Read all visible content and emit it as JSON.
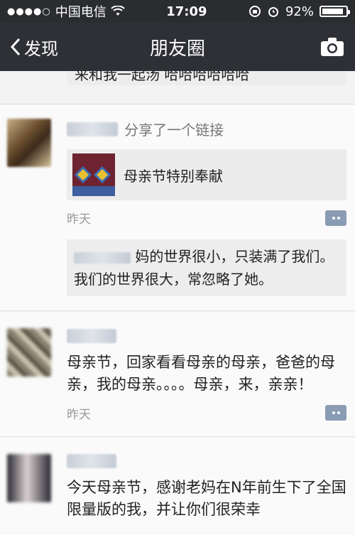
{
  "status_bar": {
    "carrier": "中国电信",
    "time": "17:09",
    "battery": "92%",
    "battery_level": 0.92
  },
  "nav": {
    "back_label": "发现",
    "title": "朋友圈"
  },
  "prev_comment_text": "来和我一起汤 哈哈哈哈哈哈",
  "posts": [
    {
      "action": "分享了一个链接",
      "link_title": "母亲节特别奉献",
      "time": "昨天",
      "comment_text": "妈的世界很小，只装满了我们。我们的世界很大，常忽略了她。"
    },
    {
      "text": "母亲节，回家看看母亲的母亲，爸爸的母亲，我的母亲。。。。母亲，来，亲亲！",
      "time": "昨天"
    },
    {
      "text": "今天母亲节，感谢老妈在N年前生下了全国限量版的我，并让你们很荣幸"
    }
  ],
  "icons": {
    "back": "chevron-left-icon",
    "camera": "camera-icon",
    "wifi": "wifi-icon",
    "alarm": "alarm-icon",
    "lock": "rotation-lock-icon",
    "comment": "comment-dots-icon"
  },
  "colors": {
    "status_bg": "#2a2c30",
    "nav_bg": "#2e3035",
    "comment_button": "#8a9bb4"
  }
}
